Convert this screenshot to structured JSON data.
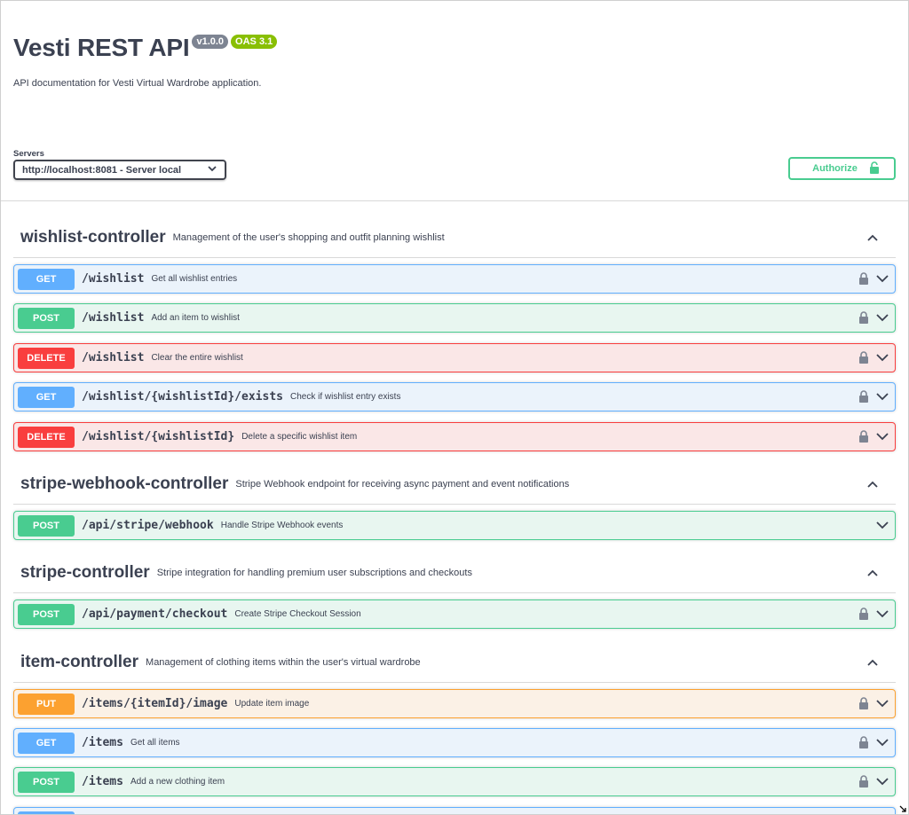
{
  "info": {
    "title": "Vesti REST API",
    "version": "v1.0.0",
    "oas": "OAS 3.1",
    "description": "API documentation for Vesti Virtual Wardrobe application."
  },
  "servers": {
    "label": "Servers",
    "selected": "http://localhost:8081 - Server local"
  },
  "authorize": {
    "label": "Authorize"
  },
  "colors": {
    "get": "#61affe",
    "post": "#49cc90",
    "delete": "#f93e3e",
    "put": "#fca130",
    "text": "#3b4151"
  },
  "tags": [
    {
      "name": "wishlist-controller",
      "description": "Management of the user's shopping and outfit planning wishlist",
      "operations": [
        {
          "method": "GET",
          "path": "/wishlist",
          "summary": "Get all wishlist entries",
          "locked": true
        },
        {
          "method": "POST",
          "path": "/wishlist",
          "summary": "Add an item to wishlist",
          "locked": true
        },
        {
          "method": "DELETE",
          "path": "/wishlist",
          "summary": "Clear the entire wishlist",
          "locked": true
        },
        {
          "method": "GET",
          "path": "/wishlist/{wishlistId}/exists",
          "summary": "Check if wishlist entry exists",
          "locked": true
        },
        {
          "method": "DELETE",
          "path": "/wishlist/{wishlistId}",
          "summary": "Delete a specific wishlist item",
          "locked": true
        }
      ]
    },
    {
      "name": "stripe-webhook-controller",
      "description": "Stripe Webhook endpoint for receiving async payment and event notifications",
      "operations": [
        {
          "method": "POST",
          "path": "/api/stripe/webhook",
          "summary": "Handle Stripe Webhook events",
          "locked": false
        }
      ]
    },
    {
      "name": "stripe-controller",
      "description": "Stripe integration for handling premium user subscriptions and checkouts",
      "operations": [
        {
          "method": "POST",
          "path": "/api/payment/checkout",
          "summary": "Create Stripe Checkout Session",
          "locked": true
        }
      ]
    },
    {
      "name": "item-controller",
      "description": "Management of clothing items within the user's virtual wardrobe",
      "operations": [
        {
          "method": "PUT",
          "path": "/items/{itemId}/image",
          "summary": "Update item image",
          "locked": true
        },
        {
          "method": "GET",
          "path": "/items",
          "summary": "Get all items",
          "locked": true
        },
        {
          "method": "POST",
          "path": "/items",
          "summary": "Add a new clothing item",
          "locked": true
        },
        {
          "method": "GET",
          "path": "",
          "summary": "",
          "locked": true
        }
      ]
    }
  ]
}
